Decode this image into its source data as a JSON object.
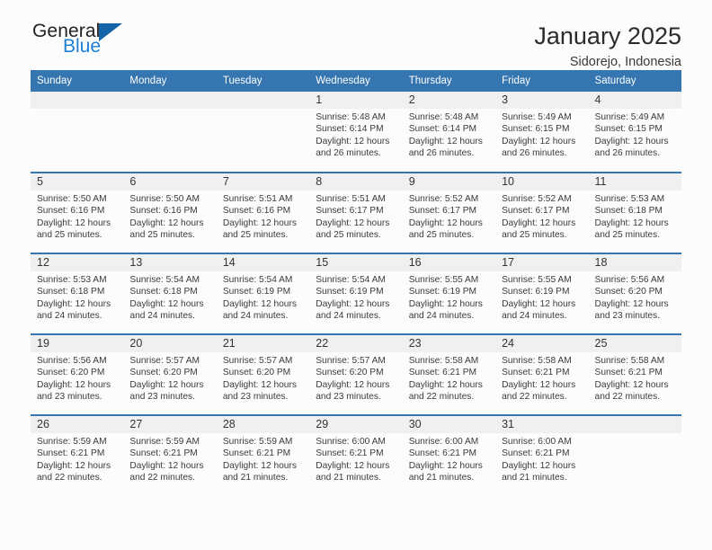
{
  "brand": {
    "name_top": "General",
    "name_bottom": "Blue",
    "triangle_color": "#1464aa",
    "blue_text_color": "#1b7fd4"
  },
  "header": {
    "title": "January 2025",
    "subtitle": "Sidorejo, Indonesia"
  },
  "theme": {
    "header_blue": "#3575b0",
    "daynum_band": "#f0f0f0",
    "page_bg": "#fcfcfd",
    "body_text": "#3b3b3b"
  },
  "weekday_headers": [
    "Sunday",
    "Monday",
    "Tuesday",
    "Wednesday",
    "Thursday",
    "Friday",
    "Saturday"
  ],
  "labels": {
    "sunrise_prefix": "Sunrise:",
    "sunset_prefix": "Sunset:",
    "daylight_prefix": "Daylight:"
  },
  "weeks": [
    [
      {
        "day": "",
        "sunrise": "",
        "sunset": "",
        "daylight": ""
      },
      {
        "day": "",
        "sunrise": "",
        "sunset": "",
        "daylight": ""
      },
      {
        "day": "",
        "sunrise": "",
        "sunset": "",
        "daylight": ""
      },
      {
        "day": "1",
        "sunrise": "Sunrise: 5:48 AM",
        "sunset": "Sunset: 6:14 PM",
        "daylight": "Daylight: 12 hours and 26 minutes."
      },
      {
        "day": "2",
        "sunrise": "Sunrise: 5:48 AM",
        "sunset": "Sunset: 6:14 PM",
        "daylight": "Daylight: 12 hours and 26 minutes."
      },
      {
        "day": "3",
        "sunrise": "Sunrise: 5:49 AM",
        "sunset": "Sunset: 6:15 PM",
        "daylight": "Daylight: 12 hours and 26 minutes."
      },
      {
        "day": "4",
        "sunrise": "Sunrise: 5:49 AM",
        "sunset": "Sunset: 6:15 PM",
        "daylight": "Daylight: 12 hours and 26 minutes."
      }
    ],
    [
      {
        "day": "5",
        "sunrise": "Sunrise: 5:50 AM",
        "sunset": "Sunset: 6:16 PM",
        "daylight": "Daylight: 12 hours and 25 minutes."
      },
      {
        "day": "6",
        "sunrise": "Sunrise: 5:50 AM",
        "sunset": "Sunset: 6:16 PM",
        "daylight": "Daylight: 12 hours and 25 minutes."
      },
      {
        "day": "7",
        "sunrise": "Sunrise: 5:51 AM",
        "sunset": "Sunset: 6:16 PM",
        "daylight": "Daylight: 12 hours and 25 minutes."
      },
      {
        "day": "8",
        "sunrise": "Sunrise: 5:51 AM",
        "sunset": "Sunset: 6:17 PM",
        "daylight": "Daylight: 12 hours and 25 minutes."
      },
      {
        "day": "9",
        "sunrise": "Sunrise: 5:52 AM",
        "sunset": "Sunset: 6:17 PM",
        "daylight": "Daylight: 12 hours and 25 minutes."
      },
      {
        "day": "10",
        "sunrise": "Sunrise: 5:52 AM",
        "sunset": "Sunset: 6:17 PM",
        "daylight": "Daylight: 12 hours and 25 minutes."
      },
      {
        "day": "11",
        "sunrise": "Sunrise: 5:53 AM",
        "sunset": "Sunset: 6:18 PM",
        "daylight": "Daylight: 12 hours and 25 minutes."
      }
    ],
    [
      {
        "day": "12",
        "sunrise": "Sunrise: 5:53 AM",
        "sunset": "Sunset: 6:18 PM",
        "daylight": "Daylight: 12 hours and 24 minutes."
      },
      {
        "day": "13",
        "sunrise": "Sunrise: 5:54 AM",
        "sunset": "Sunset: 6:18 PM",
        "daylight": "Daylight: 12 hours and 24 minutes."
      },
      {
        "day": "14",
        "sunrise": "Sunrise: 5:54 AM",
        "sunset": "Sunset: 6:19 PM",
        "daylight": "Daylight: 12 hours and 24 minutes."
      },
      {
        "day": "15",
        "sunrise": "Sunrise: 5:54 AM",
        "sunset": "Sunset: 6:19 PM",
        "daylight": "Daylight: 12 hours and 24 minutes."
      },
      {
        "day": "16",
        "sunrise": "Sunrise: 5:55 AM",
        "sunset": "Sunset: 6:19 PM",
        "daylight": "Daylight: 12 hours and 24 minutes."
      },
      {
        "day": "17",
        "sunrise": "Sunrise: 5:55 AM",
        "sunset": "Sunset: 6:19 PM",
        "daylight": "Daylight: 12 hours and 24 minutes."
      },
      {
        "day": "18",
        "sunrise": "Sunrise: 5:56 AM",
        "sunset": "Sunset: 6:20 PM",
        "daylight": "Daylight: 12 hours and 23 minutes."
      }
    ],
    [
      {
        "day": "19",
        "sunrise": "Sunrise: 5:56 AM",
        "sunset": "Sunset: 6:20 PM",
        "daylight": "Daylight: 12 hours and 23 minutes."
      },
      {
        "day": "20",
        "sunrise": "Sunrise: 5:57 AM",
        "sunset": "Sunset: 6:20 PM",
        "daylight": "Daylight: 12 hours and 23 minutes."
      },
      {
        "day": "21",
        "sunrise": "Sunrise: 5:57 AM",
        "sunset": "Sunset: 6:20 PM",
        "daylight": "Daylight: 12 hours and 23 minutes."
      },
      {
        "day": "22",
        "sunrise": "Sunrise: 5:57 AM",
        "sunset": "Sunset: 6:20 PM",
        "daylight": "Daylight: 12 hours and 23 minutes."
      },
      {
        "day": "23",
        "sunrise": "Sunrise: 5:58 AM",
        "sunset": "Sunset: 6:21 PM",
        "daylight": "Daylight: 12 hours and 22 minutes."
      },
      {
        "day": "24",
        "sunrise": "Sunrise: 5:58 AM",
        "sunset": "Sunset: 6:21 PM",
        "daylight": "Daylight: 12 hours and 22 minutes."
      },
      {
        "day": "25",
        "sunrise": "Sunrise: 5:58 AM",
        "sunset": "Sunset: 6:21 PM",
        "daylight": "Daylight: 12 hours and 22 minutes."
      }
    ],
    [
      {
        "day": "26",
        "sunrise": "Sunrise: 5:59 AM",
        "sunset": "Sunset: 6:21 PM",
        "daylight": "Daylight: 12 hours and 22 minutes."
      },
      {
        "day": "27",
        "sunrise": "Sunrise: 5:59 AM",
        "sunset": "Sunset: 6:21 PM",
        "daylight": "Daylight: 12 hours and 22 minutes."
      },
      {
        "day": "28",
        "sunrise": "Sunrise: 5:59 AM",
        "sunset": "Sunset: 6:21 PM",
        "daylight": "Daylight: 12 hours and 21 minutes."
      },
      {
        "day": "29",
        "sunrise": "Sunrise: 6:00 AM",
        "sunset": "Sunset: 6:21 PM",
        "daylight": "Daylight: 12 hours and 21 minutes."
      },
      {
        "day": "30",
        "sunrise": "Sunrise: 6:00 AM",
        "sunset": "Sunset: 6:21 PM",
        "daylight": "Daylight: 12 hours and 21 minutes."
      },
      {
        "day": "31",
        "sunrise": "Sunrise: 6:00 AM",
        "sunset": "Sunset: 6:21 PM",
        "daylight": "Daylight: 12 hours and 21 minutes."
      },
      {
        "day": "",
        "sunrise": "",
        "sunset": "",
        "daylight": ""
      }
    ]
  ]
}
